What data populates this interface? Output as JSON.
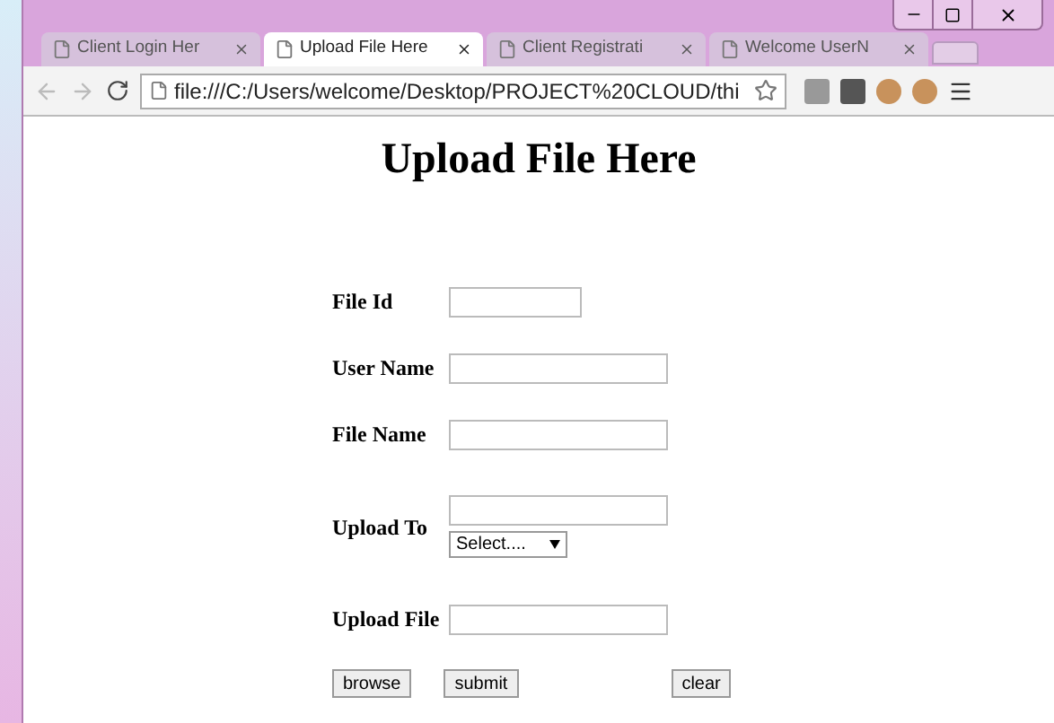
{
  "tabs": [
    {
      "title": "Client Login Her",
      "selected": false
    },
    {
      "title": "Upload File Here",
      "selected": true
    },
    {
      "title": "Client Registrati",
      "selected": false
    },
    {
      "title": "Welcome UserN",
      "selected": false
    }
  ],
  "address_bar": {
    "value": "file:///C:/Users/welcome/Desktop/PROJECT%20CLOUD/thi"
  },
  "page": {
    "heading": "Upload File Here",
    "fields": [
      {
        "label": "File Id",
        "kind": "short"
      },
      {
        "label": "User Name",
        "kind": "text"
      },
      {
        "label": "File Name",
        "kind": "text"
      },
      {
        "label": "Upload To",
        "kind": "text_select",
        "select": "Select...."
      },
      {
        "label": "Upload File",
        "kind": "text"
      }
    ],
    "buttons": [
      "browse",
      "submit",
      "clear"
    ]
  }
}
